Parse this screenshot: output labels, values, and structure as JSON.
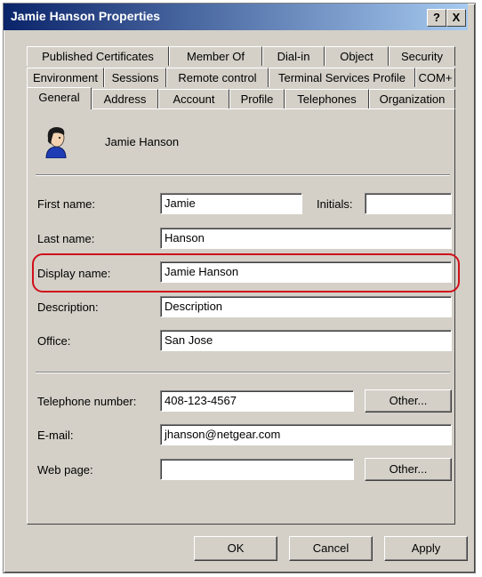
{
  "window": {
    "title": "Jamie Hanson Properties",
    "help_button": "?",
    "close_button": "X"
  },
  "tabs": {
    "row1": [
      "Published Certificates",
      "Member Of",
      "Dial-in",
      "Object",
      "Security"
    ],
    "row2": [
      "Environment",
      "Sessions",
      "Remote control",
      "Terminal Services Profile",
      "COM+"
    ],
    "row3": [
      "General",
      "Address",
      "Account",
      "Profile",
      "Telephones",
      "Organization"
    ],
    "active": "General"
  },
  "general": {
    "user_icon": "user-icon",
    "display_header": "Jamie Hanson",
    "first_name": {
      "label": "First name:",
      "value": "Jamie"
    },
    "initials": {
      "label": "Initials:",
      "value": ""
    },
    "last_name": {
      "label": "Last name:",
      "value": "Hanson"
    },
    "display_name": {
      "label": "Display name:",
      "value": "Jamie Hanson"
    },
    "description": {
      "label": "Description:",
      "value": "Description"
    },
    "office": {
      "label": "Office:",
      "value": "San Jose"
    },
    "telephone": {
      "label": "Telephone number:",
      "value": "408-123-4567",
      "other": "Other..."
    },
    "email": {
      "label": "E-mail:",
      "value": "jhanson@netgear.com"
    },
    "web_page": {
      "label": "Web page:",
      "value": "",
      "other": "Other..."
    }
  },
  "buttons": {
    "ok": "OK",
    "cancel": "Cancel",
    "apply": "Apply"
  },
  "colors": {
    "titlebar": "#0a246a",
    "face": "#d4d0c8",
    "highlight": "#d0101a"
  }
}
